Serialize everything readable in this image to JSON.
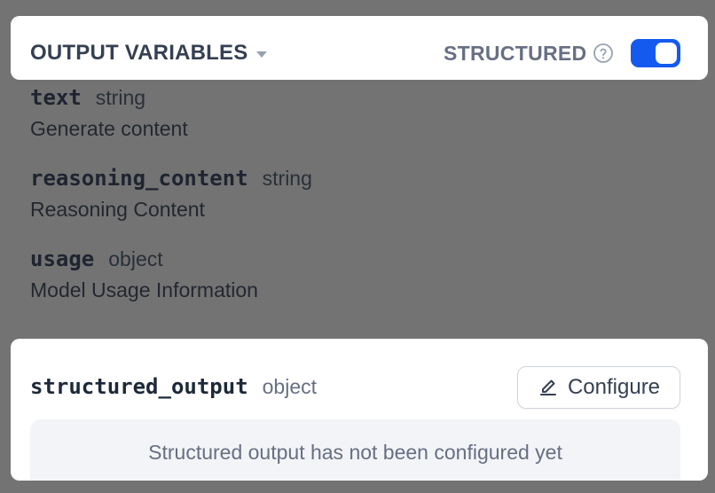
{
  "header": {
    "title": "OUTPUT VARIABLES",
    "structured_label": "STRUCTURED",
    "help_icon": "question-circle",
    "structured_enabled": true,
    "accent_color": "#155aef"
  },
  "variables": [
    {
      "name": "text",
      "type": "string",
      "description": "Generate content"
    },
    {
      "name": "reasoning_content",
      "type": "string",
      "description": "Reasoning Content"
    },
    {
      "name": "usage",
      "type": "object",
      "description": "Model Usage Information"
    }
  ],
  "structured_output": {
    "name": "structured_output",
    "type": "object",
    "configure_label": "Configure",
    "configure_icon": "pencil-icon",
    "empty_message": "Structured output has not been configured yet"
  }
}
